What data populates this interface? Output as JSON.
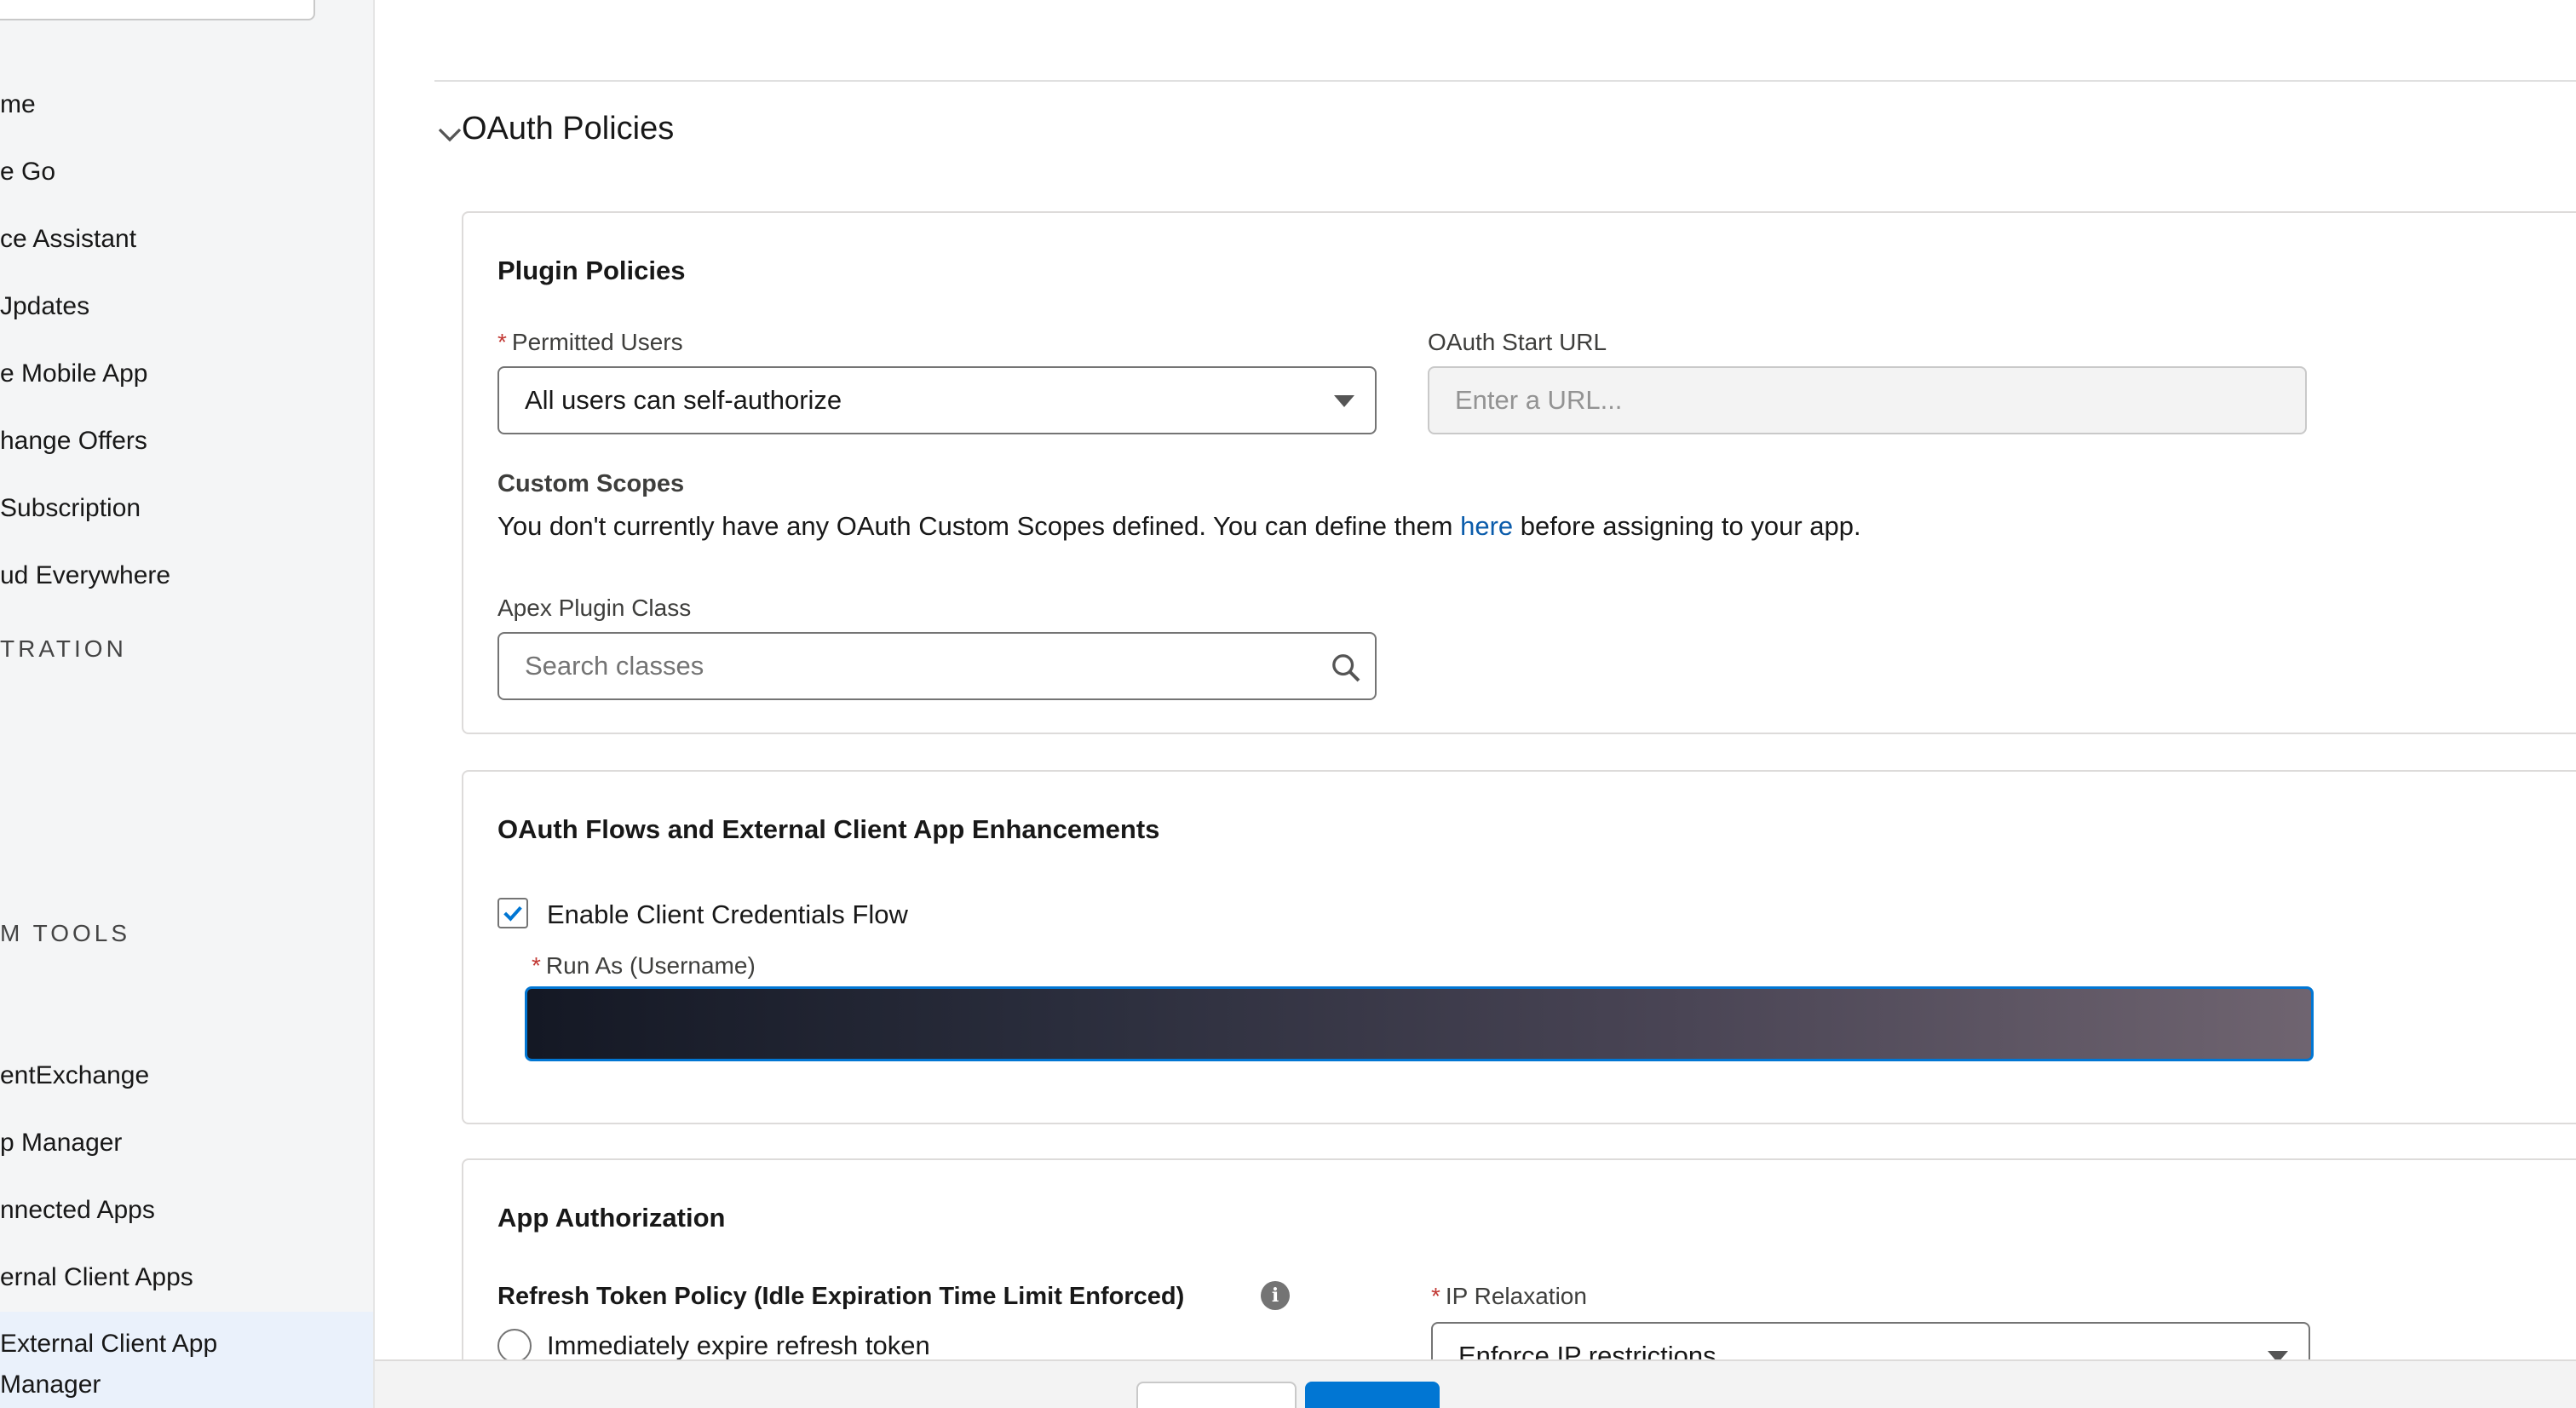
{
  "sidebar": {
    "items": [
      {
        "label": "me",
        "top": 0
      },
      {
        "label": "e Go"
      },
      {
        "label": "ce Assistant"
      },
      {
        "label": "Jpdates"
      },
      {
        "label": "e Mobile App"
      },
      {
        "label": "hange Offers"
      },
      {
        "label": "Subscription"
      },
      {
        "label": "ud Everywhere"
      }
    ],
    "heading_admin": "TRATION",
    "heading_tools": "M TOOLS",
    "tools_items": [
      {
        "label": "entExchange"
      },
      {
        "label": "p Manager"
      },
      {
        "label": "nnected Apps"
      },
      {
        "label": "ernal Client Apps"
      }
    ],
    "active_item": "External Client App\nManager"
  },
  "section": {
    "title": "OAuth Policies"
  },
  "plugin_policies": {
    "title": "Plugin Policies",
    "permitted_users_label": "Permitted Users",
    "permitted_users_value": "All users can self-authorize",
    "oauth_start_url_label": "OAuth Start URL",
    "oauth_start_url_placeholder": "Enter a URL...",
    "custom_scopes_label": "Custom Scopes",
    "custom_scopes_text_before": "You don't currently have any OAuth Custom Scopes defined. You can define them ",
    "custom_scopes_link": "here",
    "custom_scopes_text_after": " before assigning to your app.",
    "apex_plugin_label": "Apex Plugin Class",
    "apex_plugin_placeholder": "Search classes"
  },
  "oauth_flows": {
    "title": "OAuth Flows and External Client App Enhancements",
    "client_credentials_label": "Enable Client Credentials Flow",
    "client_credentials_checked": true,
    "run_as_label": "Run As (Username)"
  },
  "app_authorization": {
    "title": "App Authorization",
    "refresh_token_label": "Refresh Token Policy (Idle Expiration Time Limit Enforced)",
    "refresh_option_1": "Immediately expire refresh token",
    "ip_relaxation_label": "IP Relaxation",
    "ip_relaxation_value": "Enforce IP restrictions"
  },
  "colors": {
    "accent": "#0176d3",
    "link": "#0b5cab",
    "required": "#c23934"
  }
}
